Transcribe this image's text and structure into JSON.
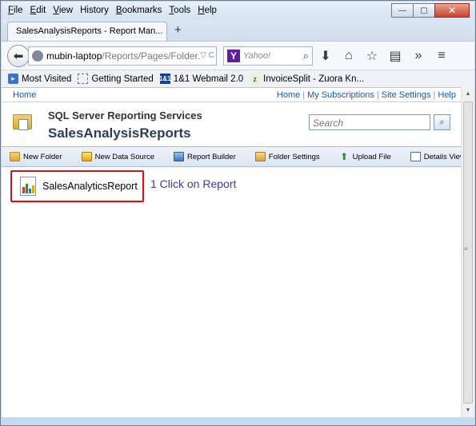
{
  "menu": [
    "File",
    "Edit",
    "View",
    "History",
    "Bookmarks",
    "Tools",
    "Help"
  ],
  "menu_accel": [
    "F",
    "E",
    "V",
    "",
    "B",
    "T",
    "H"
  ],
  "tab": {
    "title": "SalesAnalysisReports - Report Man..."
  },
  "window_controls": {
    "minimize": "—",
    "maximize": "▢",
    "close": "✕"
  },
  "url": {
    "host": "mubin-laptop",
    "path": "/Reports/Pages/Folder.",
    "tail": "▽ C"
  },
  "searchbox": {
    "placeholder": "Yahoo!"
  },
  "bookmarks": [
    {
      "label": "Most Visited",
      "icon": "most-visited-icon"
    },
    {
      "label": "Getting Started",
      "icon": "getting-started-icon"
    },
    {
      "label": "1&1 Webmail 2.0",
      "icon": "1and1-icon"
    },
    {
      "label": "InvoiceSplit - Zuora Kn...",
      "icon": "zuora-icon"
    }
  ],
  "ssrs": {
    "home": "Home",
    "top_links": [
      "Home",
      "My Subscriptions",
      "Site Settings",
      "Help"
    ],
    "product": "SQL Server Reporting Services",
    "folder": "SalesAnalysisReports",
    "search_placeholder": "Search",
    "toolbar": [
      "New Folder",
      "New Data Source",
      "Report Builder",
      "Folder Settings",
      "Upload File",
      "Details View"
    ]
  },
  "report": {
    "name": "SalesAnalyticsReport"
  },
  "annotation": "1 Click on Report",
  "colors": {
    "accent_red": "#c0191e",
    "link": "#1a55a8",
    "annotation": "#3d3a99"
  }
}
